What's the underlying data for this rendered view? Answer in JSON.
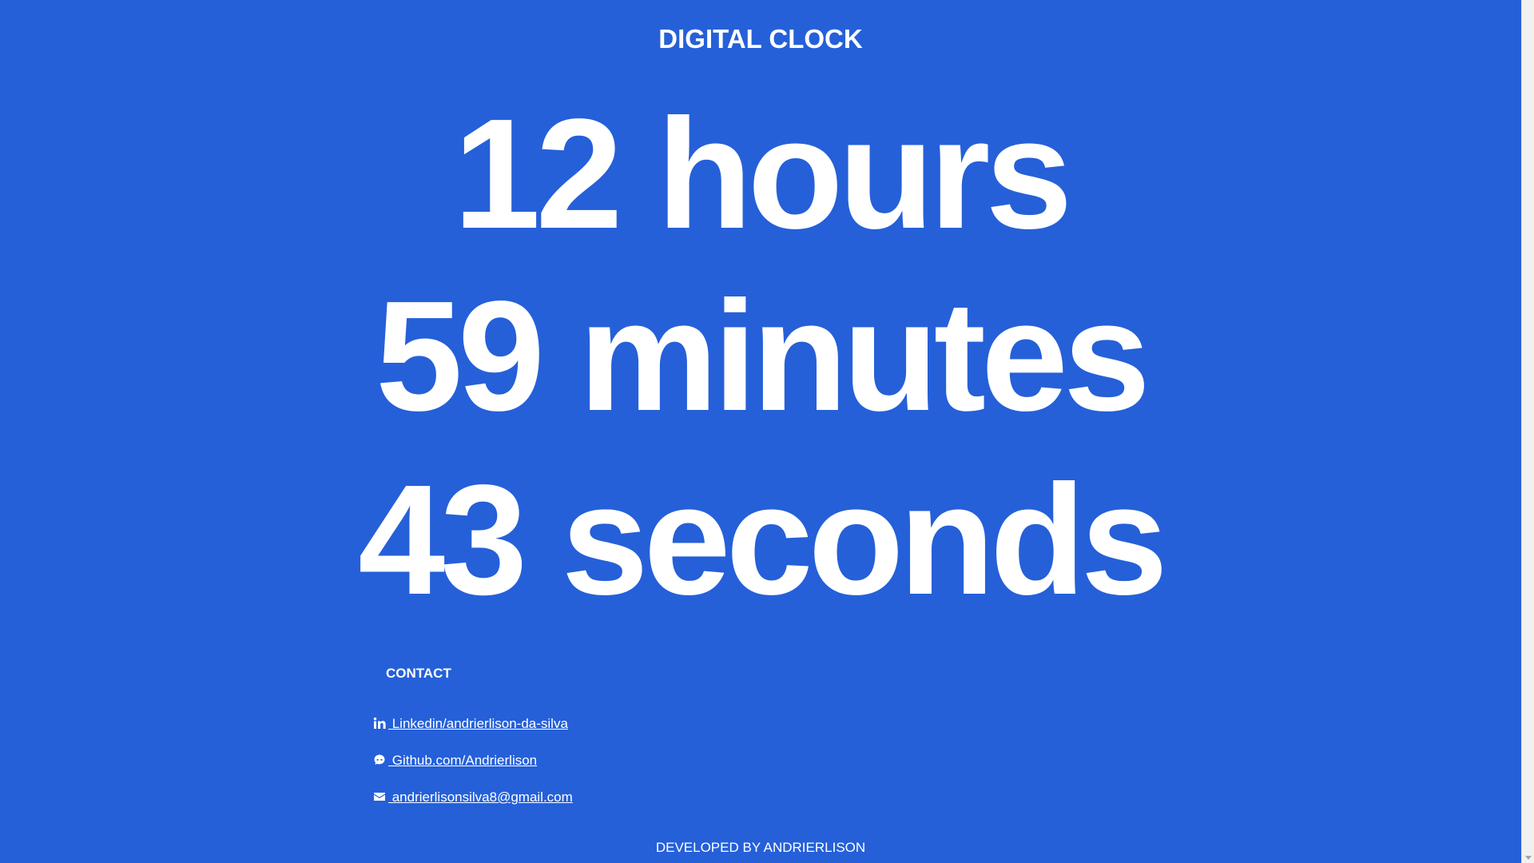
{
  "header": {
    "title": "DIGITAL CLOCK"
  },
  "clock": {
    "hours_line": "12 hours",
    "minutes_line": "59 minutes",
    "seconds_line": "43 seconds"
  },
  "contact": {
    "heading": "CONTACT",
    "items": [
      {
        "icon": "linkedin-icon",
        "label": " Linkedin/andrierlison-da-silva"
      },
      {
        "icon": "github-icon",
        "label": " Github.com/Andrierlison"
      },
      {
        "icon": "mail-icon",
        "label": " andrierlisonsilva8@gmail.com"
      }
    ]
  },
  "footer": {
    "text": "DEVELOPED BY ANDRIERLISON"
  },
  "colors": {
    "background": "#2560d9",
    "text": "#ffffff"
  }
}
